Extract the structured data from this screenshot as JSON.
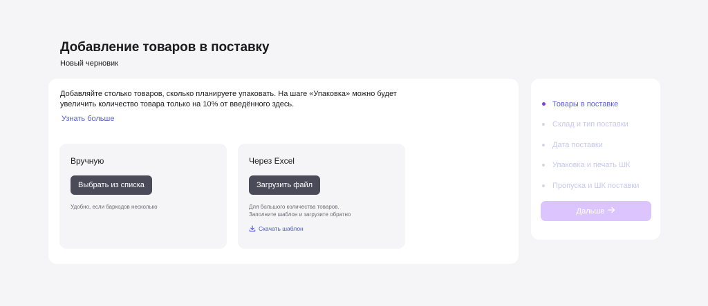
{
  "header": {
    "title": "Добавление товаров в поставку",
    "subtitle": "Новый черновик"
  },
  "main": {
    "info_line1": "Добавляйте столько товаров, сколько планируете упаковать. На шаге «Упаковка» можно будет",
    "info_line2": "увеличить количество товара только на 10% от введённого здесь.",
    "learn_more": "Узнать больше",
    "options": [
      {
        "title": "Вручную",
        "button": "Выбрать из списка",
        "hint_lines": [
          "Удобно, если баркодов несколько"
        ]
      },
      {
        "title": "Через Excel",
        "button": "Загрузить файл",
        "hint_lines": [
          "Для большого количества товаров.",
          "Заполните шаблон и загрузите обратно"
        ],
        "download_label": "Скачать шаблон",
        "download_icon": "download-icon"
      }
    ]
  },
  "steps": {
    "items": [
      {
        "label": "Товары в поставке",
        "active": true
      },
      {
        "label": "Склад и тип поставки",
        "active": false
      },
      {
        "label": "Дата поставки",
        "active": false
      },
      {
        "label": "Упаковка и печать ШК",
        "active": false
      },
      {
        "label": "Пропуска и ШК поставки",
        "active": false
      }
    ],
    "next_label": "Дальше",
    "next_icon": "arrow-right-icon"
  },
  "colors": {
    "accent": "#7a3ce8",
    "link": "#5560d6",
    "button_dark": "#4a4a58",
    "next_disabled": "#dcc5ff",
    "background": "#f5f5f7"
  }
}
